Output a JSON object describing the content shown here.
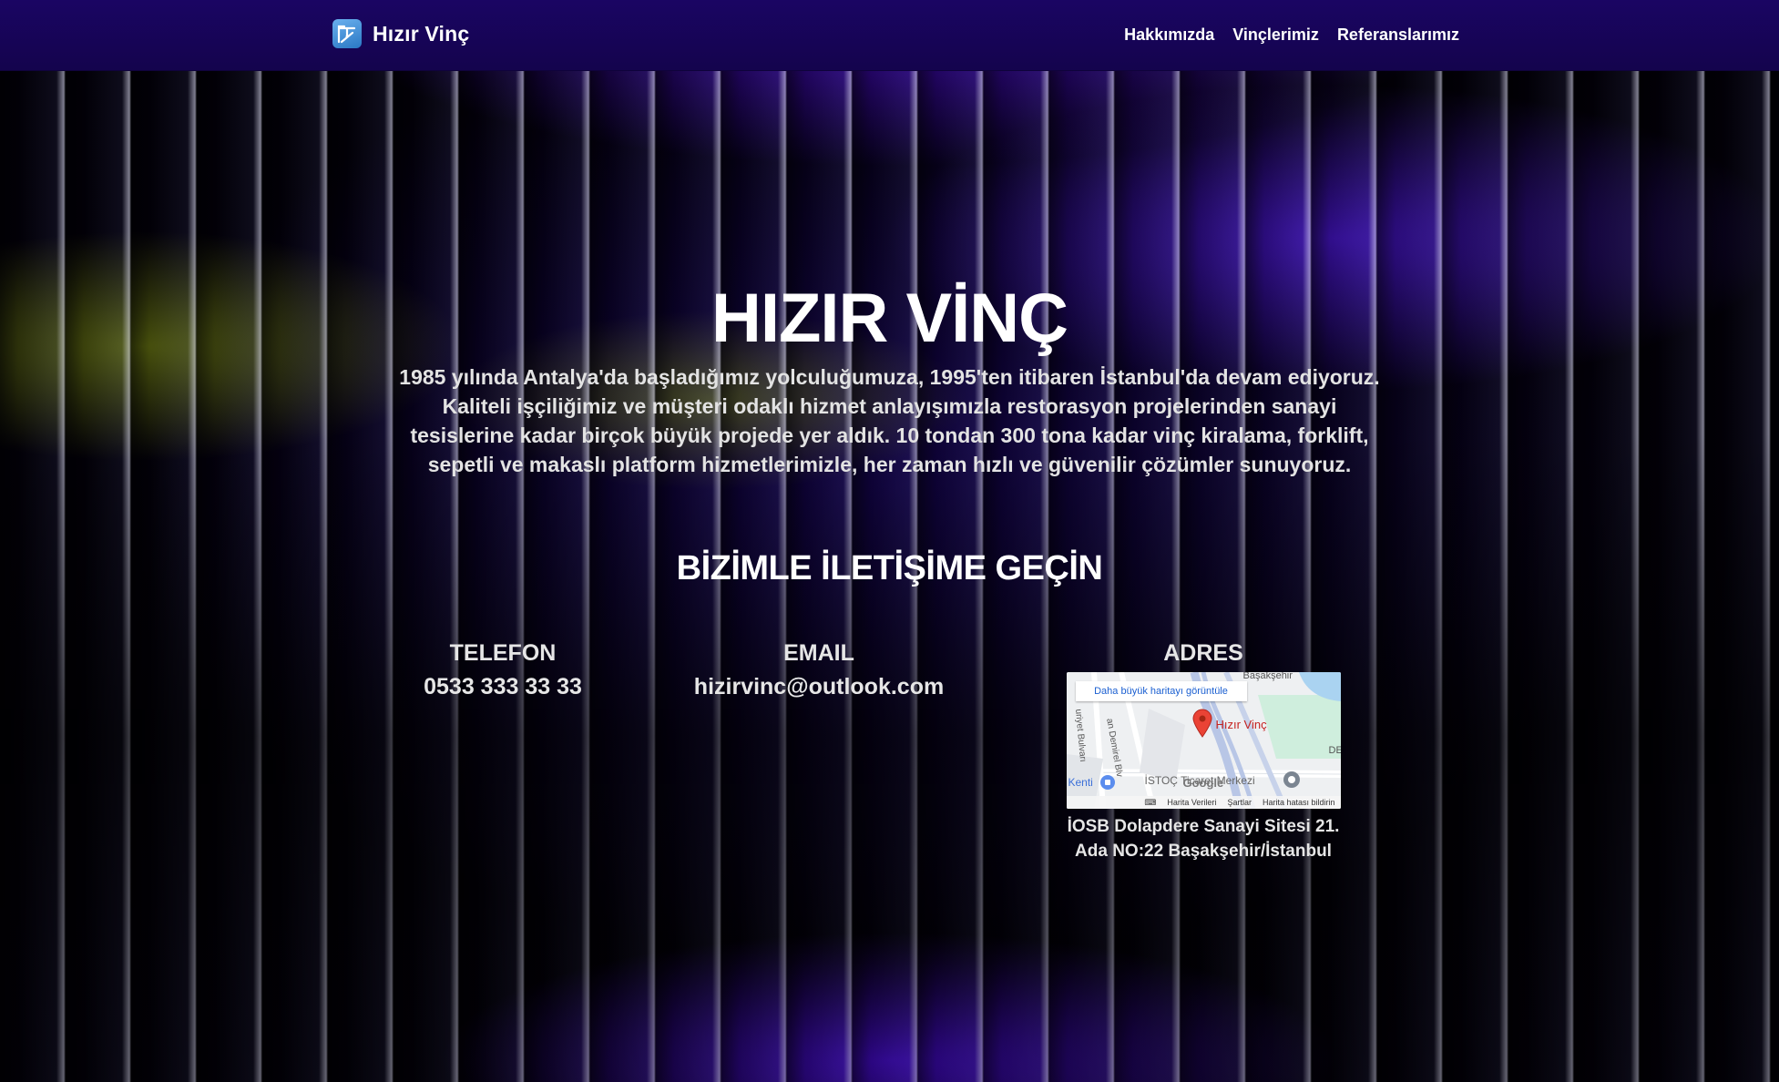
{
  "header": {
    "brand": "Hızır Vinç",
    "nav": [
      "Hakkımızda",
      "Vinçlerimiz",
      "Referanslarımız"
    ]
  },
  "hero": {
    "title": "HIZIR VİNÇ",
    "text": "1985 yılında Antalya'da başladığımız yolculuğumuza, 1995'ten itibaren İstanbul'da devam ediyoruz. Kaliteli işçiliğimiz ve müşteri odaklı hizmet anlayışımızla restorasyon projelerinden sanayi tesislerine kadar birçok büyük projede yer aldık. 10 tondan 300 tona kadar vinç kiralama, forklift, sepetli ve makaslı platform hizmetlerimizle, her zaman hızlı ve güvenilir çözümler sunuyoruz."
  },
  "contact": {
    "title": "BİZİMLE İLETİŞİME GEÇİN",
    "phone": {
      "label": "TELEFON",
      "value": "0533 333 33 33"
    },
    "email": {
      "label": "EMAIL",
      "value": "hizirvinc@outlook.com"
    },
    "address": {
      "label": "ADRES",
      "value": "İOSB Dolapdere Sanayi Sitesi 21. Ada NO:22 Başakşehir/İstanbul",
      "map": {
        "link": "Daha büyük haritayı görüntüle",
        "place": "Hızır Vinç",
        "district": "Başakşehir",
        "poi": "İSTOÇ Ticaret Merkezi",
        "poi_left": "Kenti",
        "road1": "an Demirel Blv",
        "road2": "uriyet Bulvarı",
        "edge": "DE",
        "footer": [
          "Harita Verileri",
          "Şartlar",
          "Harita hatası bildirin"
        ]
      }
    }
  },
  "colors": {
    "header": "#1a0563",
    "accent": "#3a0fd6",
    "pin": "#ea4335"
  }
}
